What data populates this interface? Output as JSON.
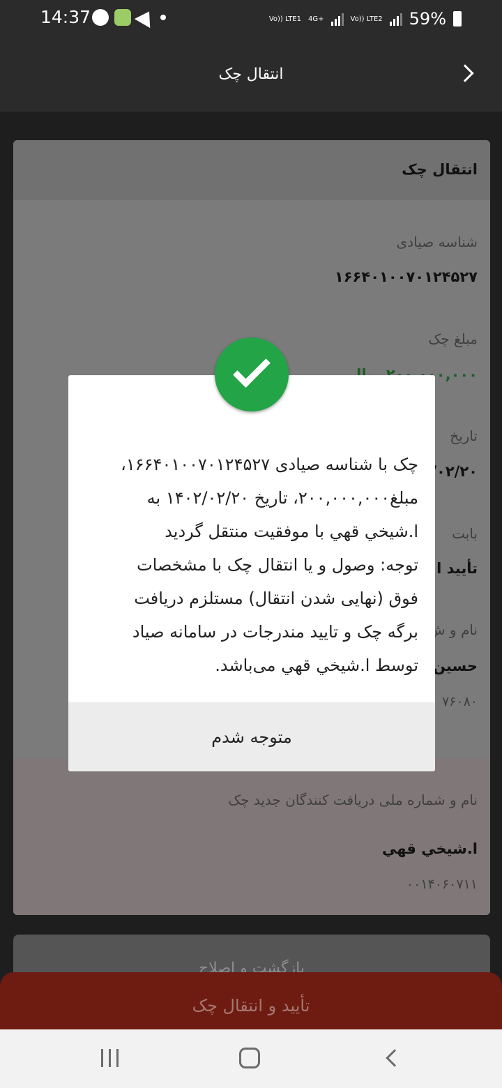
{
  "status_bar": {
    "time": "14:37",
    "sim1": "Vo)) LTE1",
    "network": "4G+",
    "sim2": "Vo)) LTE2",
    "battery": "59%"
  },
  "header": {
    "title": "انتقال چک",
    "back_icon": "chevron-right-icon"
  },
  "card": {
    "title": "انتقال چک",
    "sayad_label": "شناسه صیادی",
    "sayad_value": "۱۶۶۴۰۱۰۰۷۰۱۲۴۵۲۷",
    "amount_label": "مبلغ چک",
    "amount_value": "۲۰۰,۰۰۰,۰۰۰ ریال",
    "date_label": "تاریخ",
    "date_value": "۱۴۰۲/۰۲/۲۰",
    "reason_label": "بابت",
    "reason_value": "تأیید ا",
    "issuer_label": "نام و ش",
    "issuer_name": "حسین",
    "issuer_id": "۷۶۰۸۰",
    "receivers_label": "نام و شماره ملی دریافت کنندگان جدید چک",
    "receiver_name": "ا.شيخي قهي",
    "receiver_id": "۰۰۱۴۰۶۰۷۱۱"
  },
  "buttons": {
    "back_edit": "بازگشت و اصلاح",
    "confirm_transfer": "تأیید و انتقال چک"
  },
  "dialog": {
    "icon": "success-check-icon",
    "message": "چک با شناسه صیادی ۱۶۶۴۰۱۰۰۷۰۱۲۴۵۲۷،\nمبلغ۲۰۰,۰۰۰,۰۰۰، تاریخ ۱۴۰۲/۰۲/۲۰ به\nا.شيخي قهي با موفقیت منتقل گردید\nتوجه: وصول و یا انتقال چک با مشخصات\nفوق (نهایی شدن انتقال) مستلزم دریافت\nبرگه چک و تایید مندرجات در سامانه صیاد\nتوسط ا.شيخي قهي می‌باشد.",
    "ok_label": "متوجه شدم"
  },
  "colors": {
    "success": "#22a447",
    "confirm": "#6e1b12",
    "header_bg": "#2b2b2b"
  }
}
